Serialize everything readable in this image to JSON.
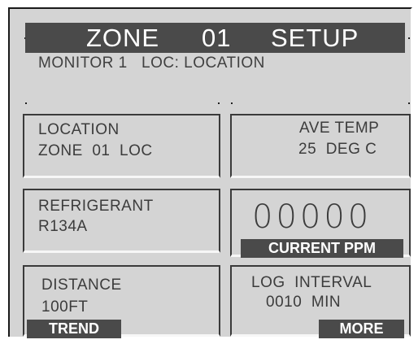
{
  "title": {
    "word1": "ZONE",
    "word2": "01",
    "word3": "SETUP"
  },
  "subtitle": "MONITOR 1   LOC: LOCATION",
  "panels": {
    "location": {
      "line1": "LOCATION",
      "line2": "ZONE  01  LOC"
    },
    "ave_temp": {
      "line1": "AVE TEMP",
      "line2": "25  DEG C"
    },
    "refrigerant": {
      "line1": "REFRIGERANT",
      "line2": "R134A"
    },
    "current_ppm": {
      "value": "00000",
      "label": "CURRENT PPM"
    },
    "distance": {
      "line1": "DISTANCE",
      "line2": "100FT",
      "button": "TREND"
    },
    "log_interval": {
      "line1": "LOG  INTERVAL",
      "line2": "0010  MIN",
      "button": "MORE"
    }
  },
  "colors": {
    "screen_bg": "#d4d4d4",
    "bar_bg": "#4a4a4a",
    "text": "#3c3c3c"
  }
}
